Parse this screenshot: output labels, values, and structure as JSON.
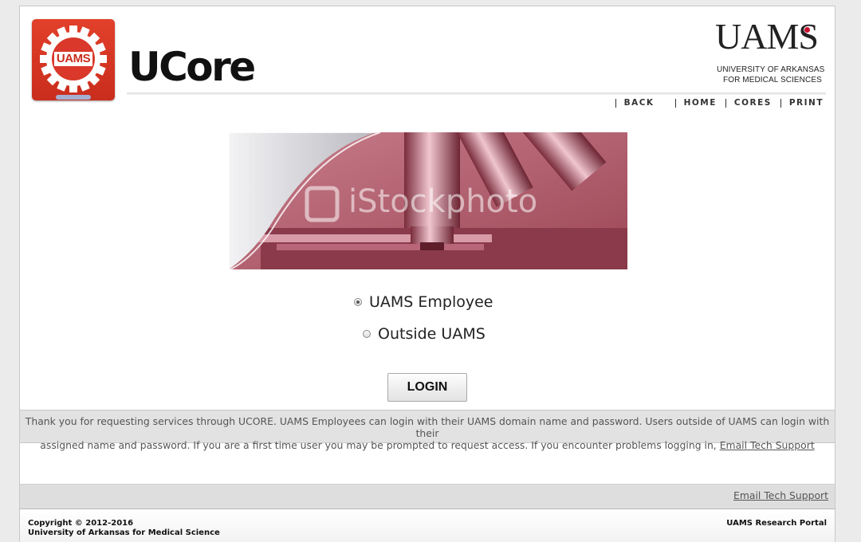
{
  "app": {
    "title": "UCore",
    "logo_text": "UAMS"
  },
  "brand": {
    "wordmark": "UAMS",
    "line1": "UNIVERSITY OF ARKANSAS",
    "line2": "FOR MEDICAL SCIENCES",
    "accent_color": "#c8102e"
  },
  "nav": {
    "back": "BACK",
    "home": "HOME",
    "cores": "CORES",
    "print": "PRINT"
  },
  "banner": {
    "watermark": "iStockphoto"
  },
  "login": {
    "options": [
      {
        "label": "UAMS Employee",
        "checked": true
      },
      {
        "label": "Outside UAMS",
        "checked": false
      }
    ],
    "button": "LOGIN"
  },
  "info": {
    "line1": "Thank you for requesting services through UCORE. UAMS Employees can login with their UAMS domain name and password. Users outside of UAMS can login with their",
    "line2": "assigned name and password. If you are a first time user you may be prompted to request access. If you encounter problems logging in,",
    "link": "Email Tech Support"
  },
  "footer": {
    "support_link": "Email Tech Support",
    "copyright_line1": "Copyright © 2012-2016",
    "copyright_line2": "University of Arkansas for Medical Science",
    "portal": "UAMS Research Portal"
  }
}
